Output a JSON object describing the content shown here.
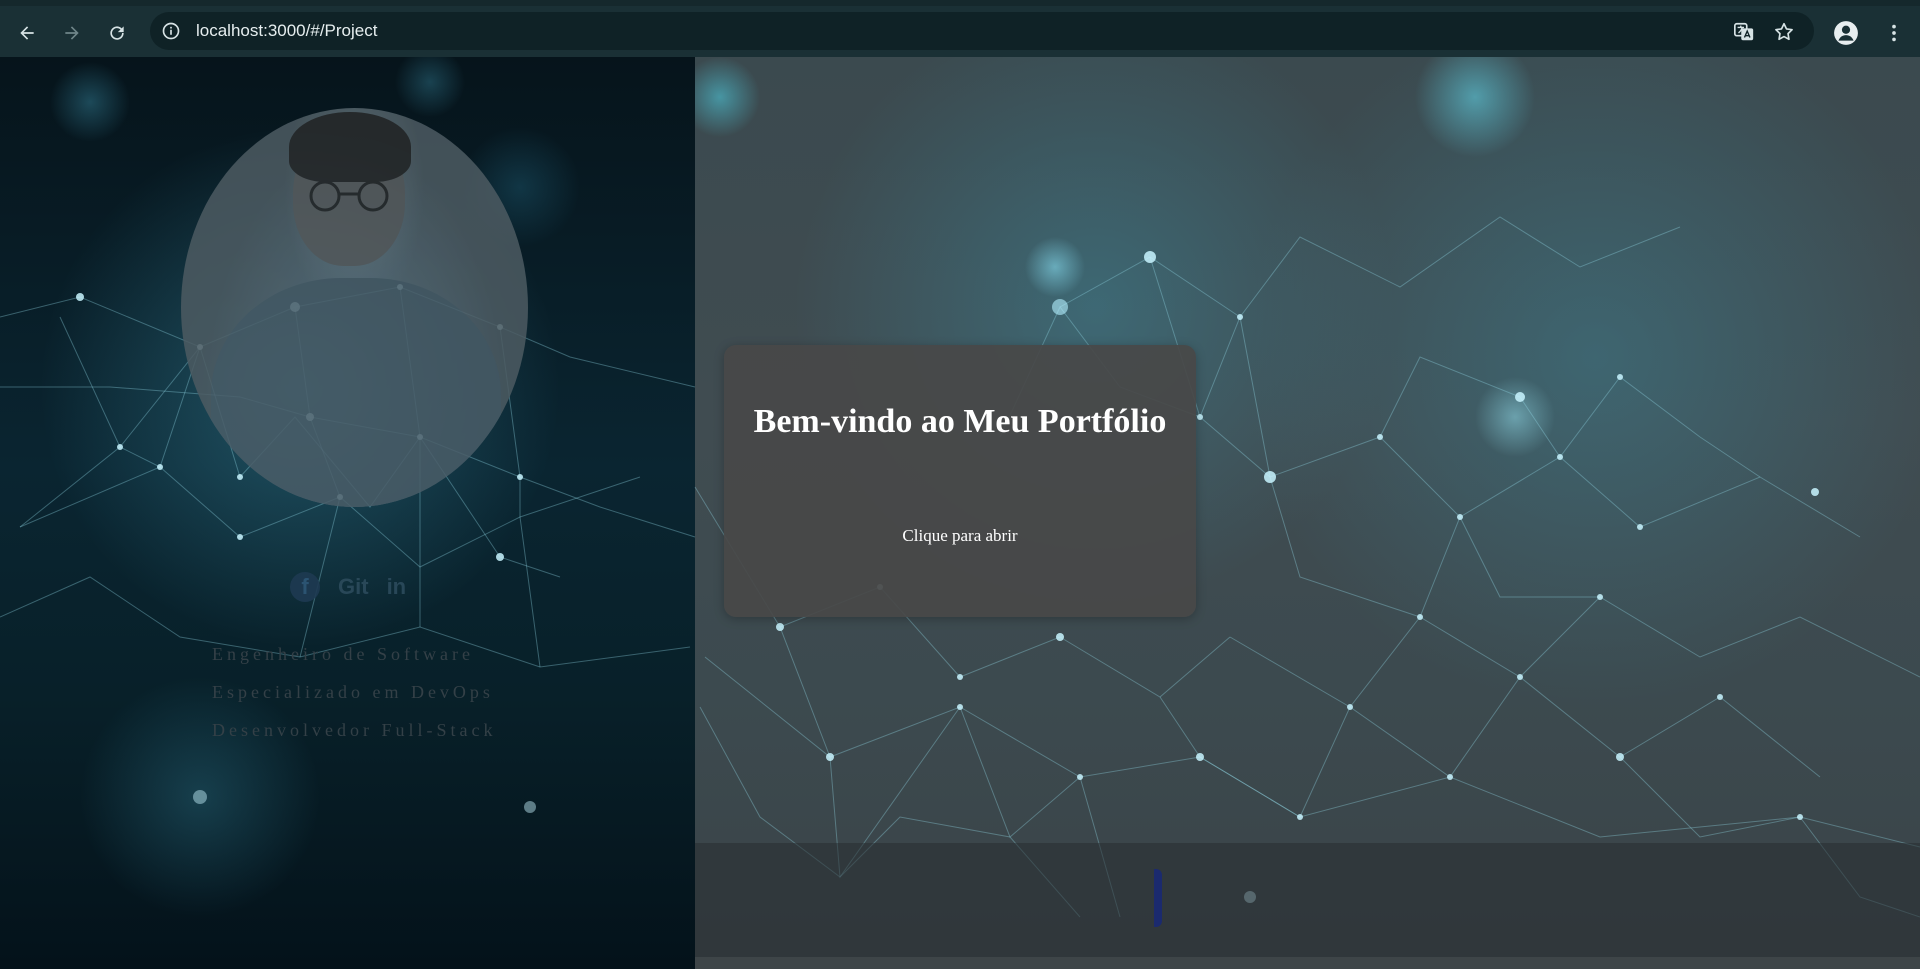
{
  "browser": {
    "url": "localhost:3000/#/Project",
    "icons": {
      "back": "arrow-left-icon",
      "forward": "arrow-right-icon",
      "reload": "reload-icon",
      "site_info": "info-icon",
      "translate": "translate-icon",
      "bookmark": "star-icon",
      "profile": "account-icon",
      "menu": "kebab-menu-icon"
    }
  },
  "profile": {
    "social": {
      "facebook": "f",
      "github": "Git",
      "linkedin": "in"
    },
    "roles": [
      "Engenheiro de Software",
      "Especializado em DevOps",
      "Desenvolvedor Full-Stack"
    ]
  },
  "card": {
    "title": "Bem-vindo ao Meu Portfólio",
    "open_label": "Clique para abrir"
  },
  "colors": {
    "chrome_bg": "#1a3035",
    "omnibox_bg": "#0f2226",
    "card_bg": "#484848",
    "indicator": "#1b2a6e"
  }
}
